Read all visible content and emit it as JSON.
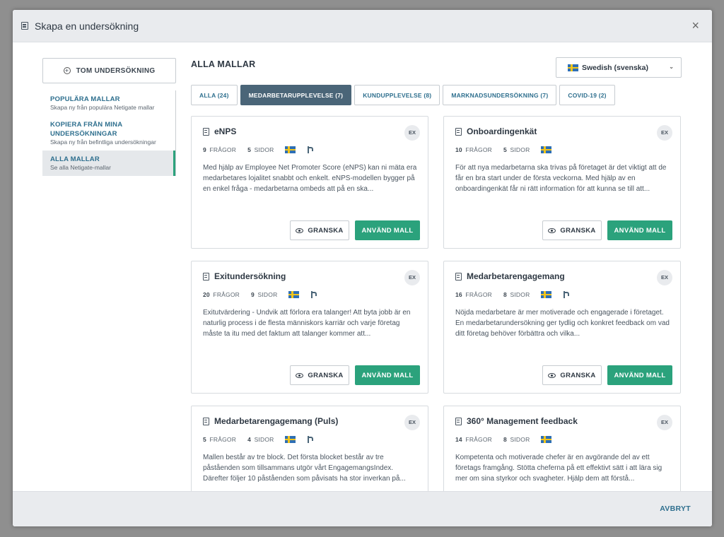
{
  "modal": {
    "title": "Skapa en undersökning",
    "close_label": "×",
    "cancel_label": "AVBRYT"
  },
  "sidebar": {
    "blank_button": "TOM UNDERSÖKNING",
    "items": [
      {
        "title": "POPULÄRA MALLAR",
        "subtitle": "Skapa ny från populära Netigate mallar",
        "active": false
      },
      {
        "title": "KOPIERA FRÅN MINA UNDERSÖKNINGAR",
        "subtitle": "Skapa ny från befintliga undersökningar",
        "active": false
      },
      {
        "title": "ALLA MALLAR",
        "subtitle": "Se alla Netigate-mallar",
        "active": true
      }
    ]
  },
  "main": {
    "section_title": "ALLA MALLAR",
    "language": "Swedish (svenska)",
    "tabs": [
      {
        "label": "ALLA (24)",
        "active": false
      },
      {
        "label": "MEDARBETARUPPLEVELSE (7)",
        "active": true
      },
      {
        "label": "KUNDUPPLEVELSE (8)",
        "active": false
      },
      {
        "label": "MARKNADSUNDERSÖKNING (7)",
        "active": false
      },
      {
        "label": "COVID-19 (2)",
        "active": false
      }
    ],
    "review_label": "GRANSKA",
    "use_label": "ANVÄND MALL",
    "ex_label": "EX",
    "questions_suffix": "FRÅGOR",
    "pages_suffix": "SIDOR",
    "cards": [
      {
        "title": "eNPS",
        "questions": "9",
        "pages": "5",
        "branching": true,
        "description": "Med hjälp av Employee Net Promoter Score (eNPS) kan ni mäta era medarbetares lojalitet snabbt och enkelt. eNPS-modellen bygger på en enkel fråga - medarbetarna ombeds att på en ska..."
      },
      {
        "title": "Onboardingenkät",
        "questions": "10",
        "pages": "5",
        "branching": false,
        "description": "För att nya medarbetarna ska trivas på företaget är det viktigt att de får en bra start under de första veckorna. Med hjälp av en onboardingenkät får ni rätt information för att kunna se till att..."
      },
      {
        "title": "Exitundersökning",
        "questions": "20",
        "pages": "9",
        "branching": true,
        "description": "Exitutvärdering - Undvik att förlora era talanger! Att byta jobb är en naturlig process i de flesta människors karriär och varje företag måste ta itu med det faktum att talanger kommer att..."
      },
      {
        "title": "Medarbetarengagemang",
        "questions": "16",
        "pages": "8",
        "branching": true,
        "description": "Nöjda medarbetare är mer motiverade och engagerade i företaget. En medarbetarundersökning ger tydlig och konkret feedback om vad ditt företag behöver förbättra och vilka..."
      },
      {
        "title": "Medarbetarengagemang (Puls)",
        "questions": "5",
        "pages": "4",
        "branching": true,
        "description": "Mallen består av tre block. Det första blocket består av tre påståenden som tillsammans utgör vårt EngagemangsIndex. Därefter följer 10 påståenden som påvisats ha stor inverkan på..."
      },
      {
        "title": "360° Management feedback",
        "questions": "14",
        "pages": "8",
        "branching": false,
        "description": "Kompetenta och motiverade chefer är en avgörande del av ett företags framgång. Stötta cheferna på ett effektivt sätt i att lära sig mer om sina styrkor och svagheter. Hjälp dem att förstå..."
      }
    ]
  }
}
